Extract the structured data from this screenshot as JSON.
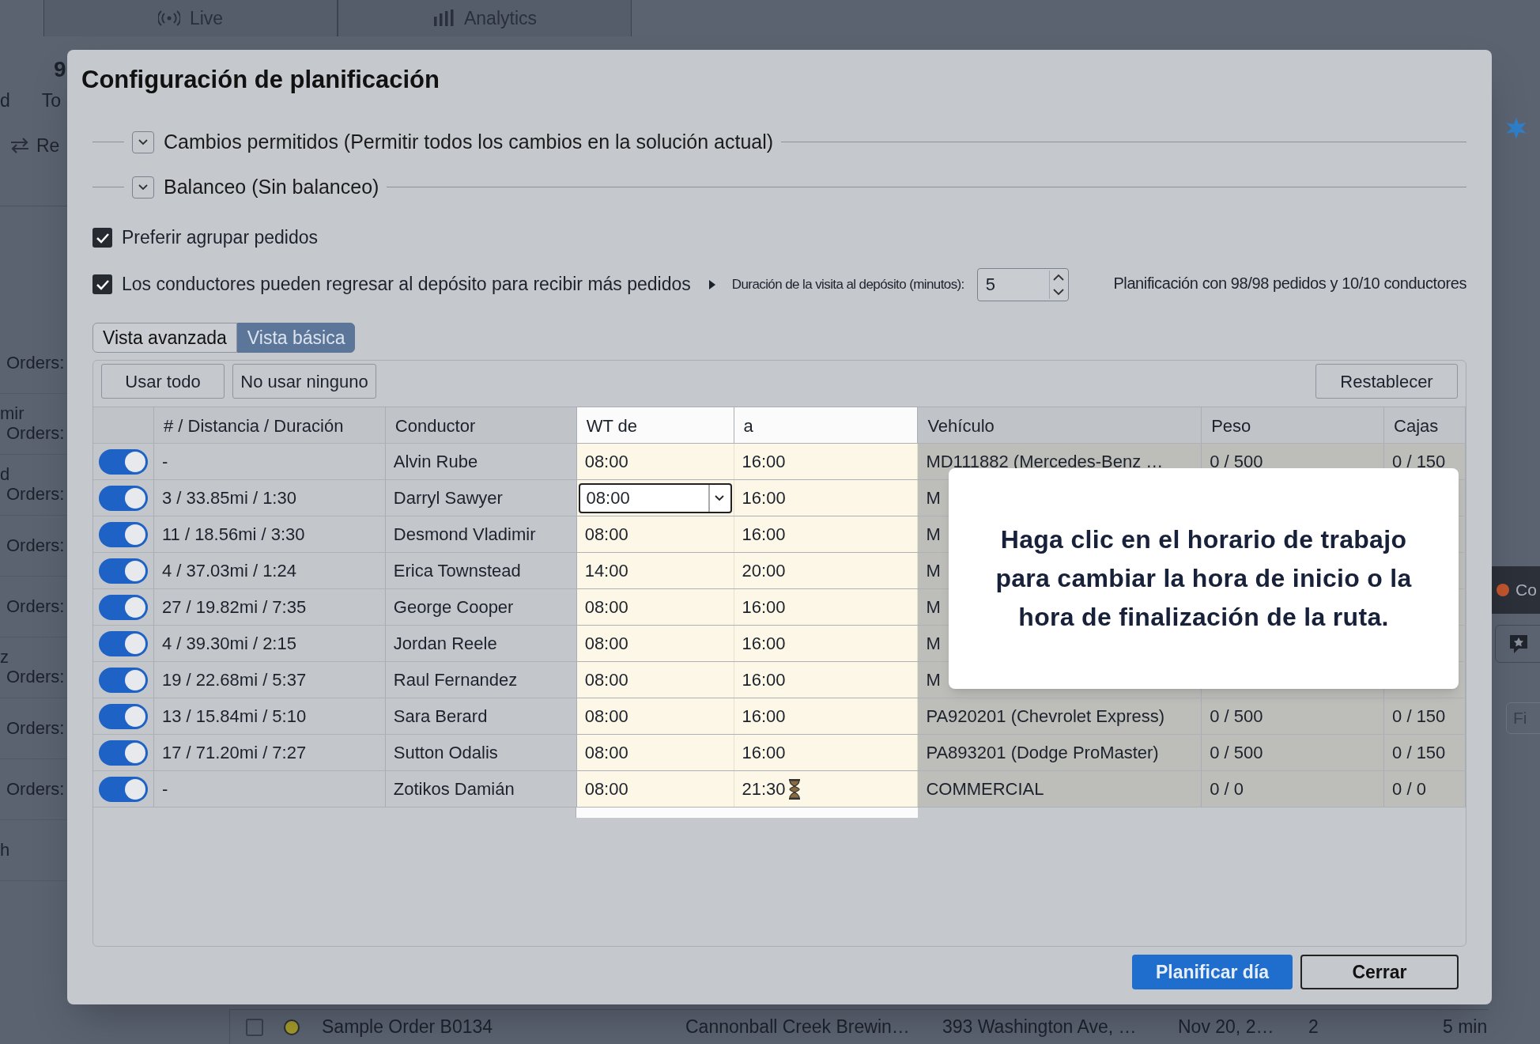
{
  "background": {
    "tabs": [
      {
        "label": "Live"
      },
      {
        "label": "Analytics"
      }
    ],
    "summary": {
      "value": "9",
      "label_left": "d",
      "label_right": "To"
    },
    "action": "Re",
    "rows": [
      {
        "orders": "Orders:"
      },
      {
        "name": "mir",
        "orders": "Orders:"
      },
      {
        "name": "d",
        "orders": "Orders:"
      },
      {
        "orders": "Orders:"
      },
      {
        "orders": "Orders:"
      },
      {
        "name": "z",
        "orders": "Orders:"
      },
      {
        "orders": "Orders:"
      },
      {
        "orders": "Orders:"
      },
      {
        "name": "h"
      }
    ],
    "side_label": "Co",
    "side_button": "Fi",
    "order_row": {
      "checked": false,
      "color": "#a39a2c",
      "name": "Sample Order B0134",
      "customer": "Cannonball Creek Brewin…",
      "address": "393 Washington Ave, …",
      "date": "Nov 20, 2…",
      "count": "2",
      "time": "5 min"
    }
  },
  "dialog": {
    "title": "Configuración de planificación",
    "sections": [
      {
        "label": "Cambios permitidos (Permitir todos los cambios en la solución actual)",
        "expanded": false
      },
      {
        "label": "Balanceo (Sin balanceo)",
        "expanded": false
      }
    ],
    "options": [
      {
        "label": "Preferir agrupar pedidos",
        "checked": true
      },
      {
        "label": "Los conductores pueden regresar al depósito para recibir más pedidos",
        "checked": true
      }
    ],
    "visit_duration": {
      "label": "Duración de la visita al depósito (minutos):",
      "value": "5"
    },
    "summary": "Planificación con 98/98 pedidos y 10/10 conductores",
    "tabs": [
      {
        "label": "Vista avanzada",
        "selected": false
      },
      {
        "label": "Vista básica",
        "selected": true
      }
    ],
    "buttons": {
      "use_all": "Usar todo",
      "use_none": "No usar ninguno",
      "reset": "Restablecer"
    },
    "columns": [
      "# / Distancia / Duración",
      "Conductor",
      "WT de",
      "a",
      "Vehículo",
      "Peso",
      "Cajas"
    ],
    "rows": [
      {
        "on": true,
        "stats": "-",
        "driver": "Alvin Rube",
        "from": "08:00",
        "to": "16:00",
        "editing": false,
        "warning": false,
        "vehicle": "MD111882 (Mercedes-Benz …",
        "weight": "0 / 500",
        "boxes": "0 / 150"
      },
      {
        "on": true,
        "stats": "3 / 33.85mi / 1:30",
        "driver": "Darryl Sawyer",
        "from": "08:00",
        "to": "16:00",
        "editing": true,
        "warning": false,
        "vehicle": "M"
      },
      {
        "on": true,
        "stats": "11 / 18.56mi / 3:30",
        "driver": "Desmond Vladimir",
        "from": "08:00",
        "to": "16:00",
        "editing": false,
        "warning": false,
        "vehicle": "M"
      },
      {
        "on": true,
        "stats": "4 / 37.03mi / 1:24",
        "driver": "Erica Townstead",
        "from": "14:00",
        "to": "20:00",
        "editing": false,
        "warning": false,
        "vehicle": "M"
      },
      {
        "on": true,
        "stats": "27 / 19.82mi / 7:35",
        "driver": "George Cooper",
        "from": "08:00",
        "to": "16:00",
        "editing": false,
        "warning": false,
        "vehicle": "M"
      },
      {
        "on": true,
        "stats": "4 / 39.30mi / 2:15",
        "driver": "Jordan Reele",
        "from": "08:00",
        "to": "16:00",
        "editing": false,
        "warning": false,
        "vehicle": "M"
      },
      {
        "on": true,
        "stats": "19 / 22.68mi / 5:37",
        "driver": "Raul Fernandez",
        "from": "08:00",
        "to": "16:00",
        "editing": false,
        "warning": false,
        "vehicle": "M"
      },
      {
        "on": true,
        "stats": "13 / 15.84mi / 5:10",
        "driver": "Sara Berard",
        "from": "08:00",
        "to": "16:00",
        "editing": false,
        "warning": false,
        "vehicle": "PA920201 (Chevrolet Express)",
        "weight": "0 / 500",
        "boxes": "0 / 150"
      },
      {
        "on": true,
        "stats": "17 / 71.20mi / 7:27",
        "driver": "Sutton Odalis",
        "from": "08:00",
        "to": "16:00",
        "editing": false,
        "warning": false,
        "vehicle": "PA893201 (Dodge ProMaster)",
        "weight": "0 / 500",
        "boxes": "0 / 150"
      },
      {
        "on": true,
        "stats": "-",
        "driver": "Zotikos Damián",
        "from": "08:00",
        "to": "21:30",
        "editing": false,
        "warning": true,
        "vehicle": "COMMERCIAL",
        "weight": "0 / 0",
        "boxes": "0 / 0"
      }
    ],
    "tooltip": "Haga clic en el horario de trabajo para cambiar la hora de inicio o la hora de finalización de la ruta.",
    "primary_button": "Planificar día",
    "close_button": "Cerrar"
  }
}
